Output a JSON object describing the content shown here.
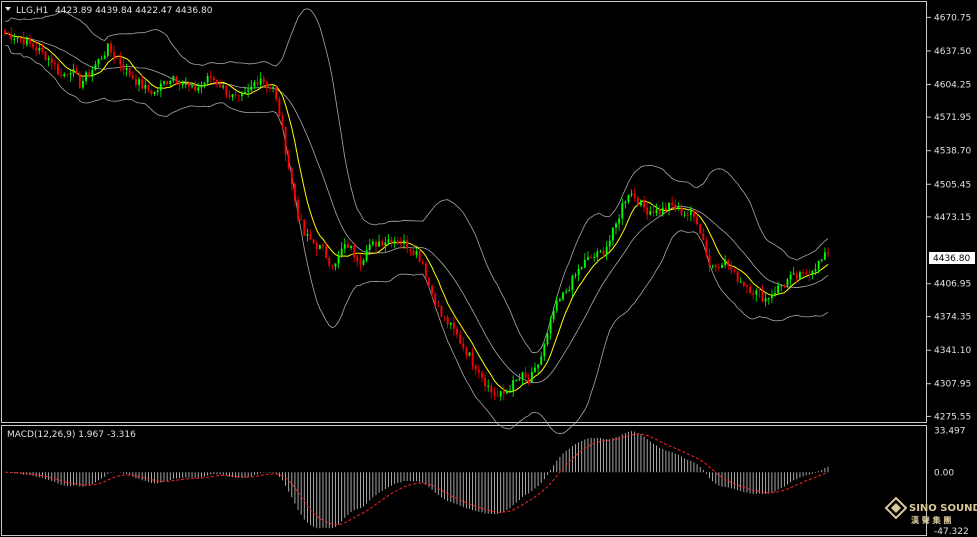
{
  "window": {
    "symbol_label": "LLG,H1",
    "ohlc": "4423.89 4439.84 4422.47 4436.80",
    "current_price": "4436.80",
    "macd_label": "MACD(12,26,9) 1.967 -3.316"
  },
  "logo": {
    "name": "SINO SOUND",
    "subtitle": "漢 聲 集 團"
  },
  "colors": {
    "background": "#000000",
    "frame": "#c8c8c8",
    "bull": "#00ff00",
    "bear": "#ff0000",
    "bands": "#a8a8a8",
    "ma": "#ffff00",
    "macd_hist": "#d0d0d0",
    "signal": "#ff2020"
  },
  "chart_data": [
    {
      "type": "candlestick",
      "symbol": "LLG",
      "timeframe": "H1",
      "y_ticks": [
        "4670.75",
        "4637.50",
        "4604.25",
        "4571.95",
        "4538.70",
        "4505.45",
        "4473.15",
        "4436.80",
        "4406.95",
        "4374.35",
        "4341.10",
        "4307.95",
        "4275.55"
      ],
      "ylim": [
        4272,
        4682
      ],
      "overlays": [
        "Bollinger Bands",
        "Moving Average"
      ],
      "close_path": [
        [
          0,
          4655
        ],
        [
          5,
          4650
        ],
        [
          10,
          4640
        ],
        [
          15,
          4628
        ],
        [
          18,
          4612
        ],
        [
          21,
          4620
        ],
        [
          24,
          4605
        ],
        [
          27,
          4615
        ],
        [
          30,
          4628
        ],
        [
          33,
          4640
        ],
        [
          36,
          4630
        ],
        [
          39,
          4618
        ],
        [
          42,
          4608
        ],
        [
          45,
          4600
        ],
        [
          48,
          4596
        ],
        [
          51,
          4606
        ],
        [
          54,
          4613
        ],
        [
          57,
          4606
        ],
        [
          60,
          4598
        ],
        [
          63,
          4604
        ],
        [
          66,
          4612
        ],
        [
          69,
          4604
        ],
        [
          72,
          4594
        ],
        [
          75,
          4588
        ],
        [
          78,
          4596
        ],
        [
          80,
          4606
        ],
        [
          82,
          4612
        ],
        [
          84,
          4604
        ],
        [
          86,
          4600
        ],
        [
          88,
          4575
        ],
        [
          90,
          4540
        ],
        [
          92,
          4505
        ],
        [
          94,
          4475
        ],
        [
          96,
          4455
        ],
        [
          98,
          4450
        ],
        [
          100,
          4445
        ],
        [
          102,
          4440
        ],
        [
          104,
          4430
        ],
        [
          106,
          4425
        ],
        [
          108,
          4440
        ],
        [
          110,
          4445
        ],
        [
          112,
          4437
        ],
        [
          114,
          4430
        ],
        [
          116,
          4440
        ],
        [
          118,
          4445
        ],
        [
          120,
          4449
        ],
        [
          122,
          4450
        ],
        [
          124,
          4452
        ],
        [
          126,
          4450
        ],
        [
          128,
          4447
        ],
        [
          130,
          4443
        ],
        [
          132,
          4438
        ],
        [
          134,
          4428
        ],
        [
          136,
          4405
        ],
        [
          138,
          4390
        ],
        [
          140,
          4375
        ],
        [
          142,
          4368
        ],
        [
          144,
          4360
        ],
        [
          146,
          4350
        ],
        [
          148,
          4340
        ],
        [
          150,
          4330
        ],
        [
          152,
          4322
        ],
        [
          154,
          4310
        ],
        [
          156,
          4300
        ],
        [
          158,
          4295
        ],
        [
          160,
          4298
        ],
        [
          162,
          4305
        ],
        [
          164,
          4310
        ],
        [
          166,
          4315
        ],
        [
          168,
          4310
        ],
        [
          170,
          4320
        ],
        [
          172,
          4335
        ],
        [
          174,
          4355
        ],
        [
          176,
          4380
        ],
        [
          178,
          4390
        ],
        [
          180,
          4400
        ],
        [
          182,
          4410
        ],
        [
          184,
          4420
        ],
        [
          186,
          4428
        ],
        [
          188,
          4433
        ],
        [
          190,
          4435
        ],
        [
          192,
          4440
        ],
        [
          194,
          4450
        ],
        [
          196,
          4465
        ],
        [
          198,
          4485
        ],
        [
          200,
          4498
        ],
        [
          202,
          4494
        ],
        [
          204,
          4485
        ],
        [
          206,
          4480
        ],
        [
          208,
          4480
        ],
        [
          210,
          4478
        ],
        [
          212,
          4482
        ],
        [
          214,
          4484
        ],
        [
          216,
          4480
        ],
        [
          218,
          4477
        ],
        [
          220,
          4475
        ],
        [
          222,
          4470
        ],
        [
          224,
          4450
        ],
        [
          226,
          4425
        ],
        [
          228,
          4425
        ],
        [
          230,
          4430
        ],
        [
          232,
          4425
        ],
        [
          234,
          4415
        ],
        [
          236,
          4410
        ],
        [
          238,
          4405
        ],
        [
          240,
          4400
        ],
        [
          242,
          4396
        ],
        [
          244,
          4392
        ],
        [
          246,
          4398
        ],
        [
          248,
          4403
        ],
        [
          250,
          4408
        ],
        [
          252,
          4412
        ],
        [
          254,
          4413
        ],
        [
          256,
          4415
        ],
        [
          258,
          4420
        ],
        [
          260,
          4425
        ],
        [
          262,
          4430
        ],
        [
          264,
          4436.8
        ]
      ]
    },
    {
      "type": "macd",
      "name": "MACD(12,26,9)",
      "macd": 1.967,
      "signal": -3.316,
      "y_ticks": [
        "33.497",
        "0.00",
        "-47.322"
      ],
      "ylim": [
        -48,
        34
      ]
    }
  ]
}
